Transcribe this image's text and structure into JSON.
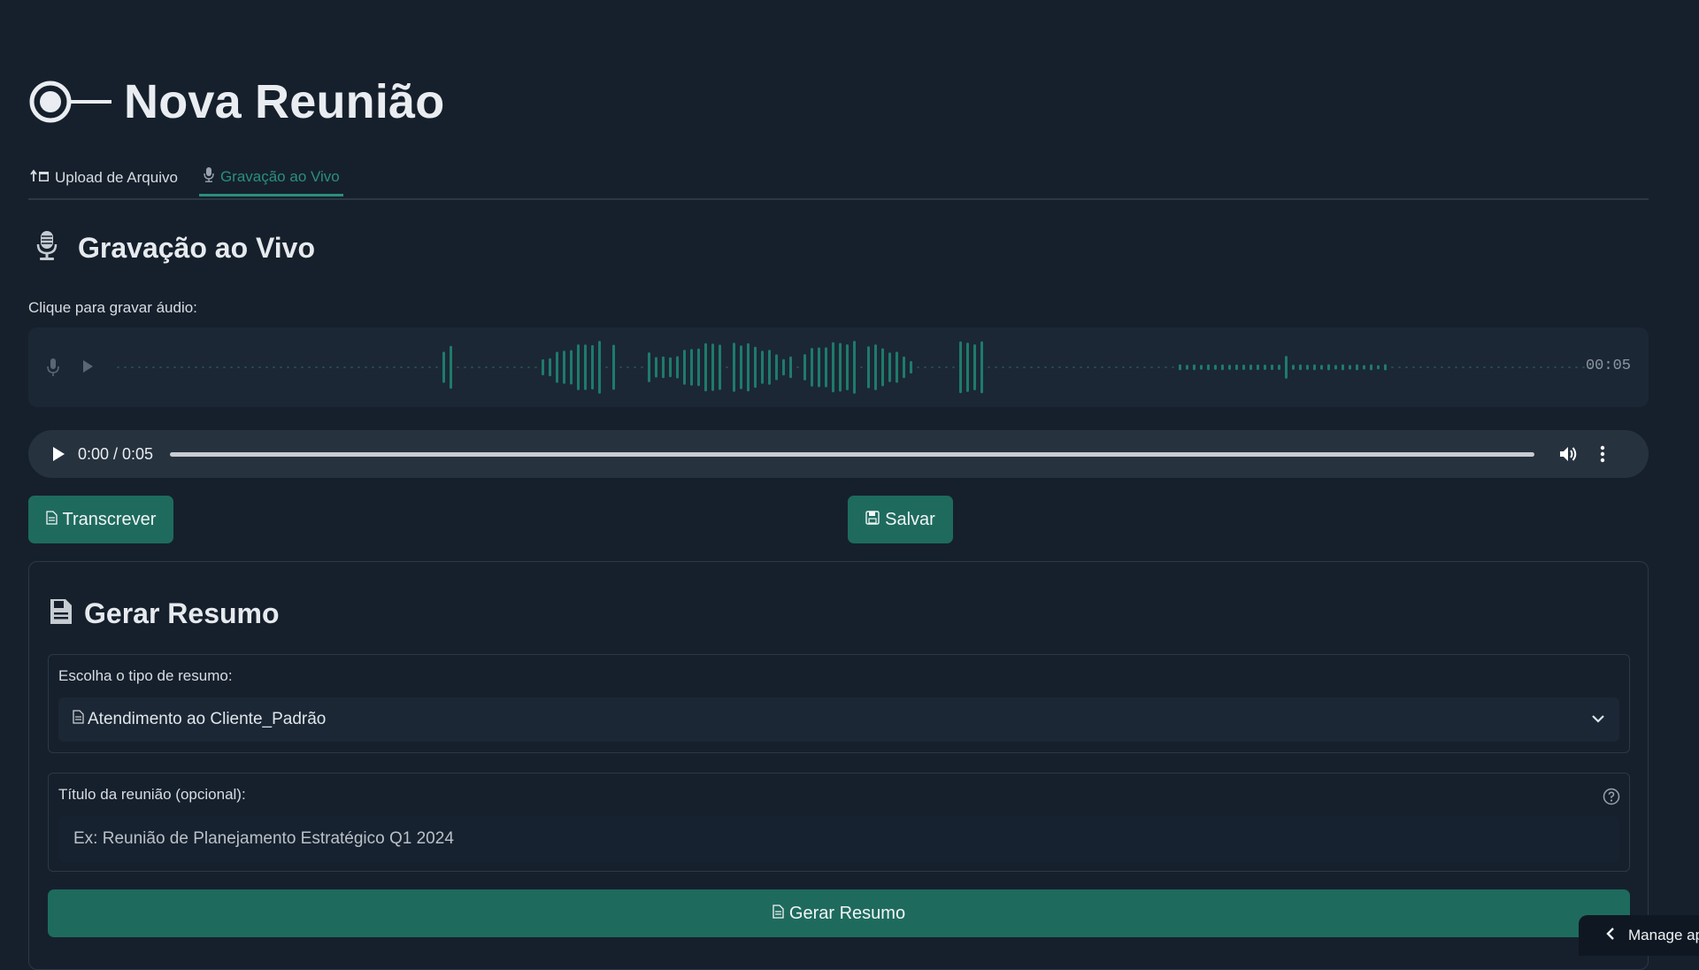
{
  "page": {
    "title": "Nova Reunião"
  },
  "tabs": [
    {
      "label": "Upload de Arquivo",
      "icon": "upload-icon",
      "active": false
    },
    {
      "label": "Gravação ao Vivo",
      "icon": "microphone-icon",
      "active": true
    }
  ],
  "live_recording": {
    "heading": "Gravação ao Vivo",
    "record_prompt": "Clique para gravar áudio:",
    "duration": "00:05"
  },
  "audio_player": {
    "time": "0:00 / 0:05",
    "progress": 0
  },
  "actions": {
    "transcribe_label": "Transcrever",
    "save_label": "Salvar"
  },
  "summary": {
    "heading": "Gerar Resumo",
    "type_label": "Escolha o tipo de resumo:",
    "type_selected": "Atendimento ao Cliente_Padrão",
    "title_label": "Título da reunião (opcional):",
    "title_placeholder": "Ex: Reunião de Planejamento Estratégico Q1 2024",
    "title_value": "",
    "generate_label": "Gerar Resumo"
  },
  "manage_app": {
    "label": "Manage app"
  },
  "colors": {
    "background": "#16202c",
    "accent": "#1e6b5e",
    "accent_text": "#2a8f7c",
    "panel_border": "#2c3846"
  }
}
